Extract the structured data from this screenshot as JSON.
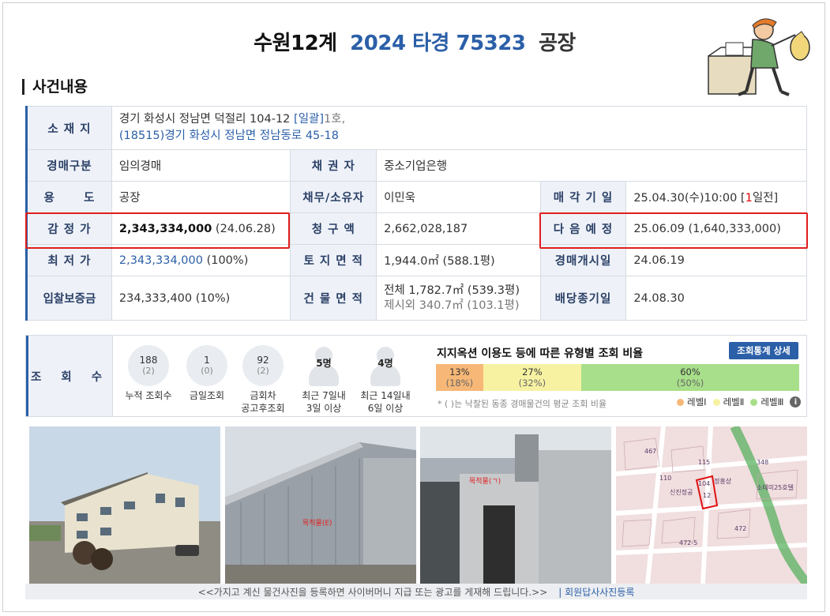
{
  "header": {
    "court": "수원12계",
    "case_no": "2024 타경 75323",
    "category": "공장"
  },
  "section_title": "사건내용",
  "info": {
    "address": {
      "label": "소 재 지",
      "line1": "경기 화성시 정남면 덕절리 104-12",
      "bulk": "[일괄]",
      "line1_suffix": "1호,",
      "line2": "(18515)경기 화성시  정남면 정남동로  45-18"
    },
    "auction_type": {
      "label": "경매구분",
      "value": "임의경매"
    },
    "creditor": {
      "label": "채 권 자",
      "value": "중소기업은행"
    },
    "usage": {
      "label": "용      도",
      "value": "공장"
    },
    "debtor_owner": {
      "label": "채무/소유자",
      "value": "이민욱"
    },
    "sale_date": {
      "label": "매 각 기 일",
      "value_pre": "25.04.30(수)10:00 [",
      "value_red": "1",
      "value_post": "일전]"
    },
    "appraisal": {
      "label": "감 정 가",
      "value": "2,343,334,000",
      "date": "(24.06.28)"
    },
    "claim_amount": {
      "label": "청 구 액",
      "value": "2,662,028,187"
    },
    "next_schedule": {
      "label": "다 음 예 정",
      "value": "25.06.09 (1,640,333,000)"
    },
    "min_price": {
      "label": "최 저 가",
      "value": "2,343,334,000",
      "pct": "(100%)"
    },
    "land_area": {
      "label": "토 지 면 적",
      "value": "1,944.0㎡ (588.1평)"
    },
    "start_date": {
      "label": "경매개시일",
      "value": "24.06.19"
    },
    "deposit": {
      "label": "입찰보증금",
      "value": "234,333,400 (10%)"
    },
    "building_area": {
      "label": "건 물 면 적",
      "line1": "전체 1,782.7㎡ (539.3평)",
      "line2": "제시외 340.7㎡ (103.1평)"
    },
    "dividend_deadline": {
      "label": "배당종기일",
      "value": "24.08.30"
    }
  },
  "views": {
    "label": "조 회 수",
    "stats": [
      {
        "value": "188",
        "sub": "(2)",
        "caption1": "누적 조회수",
        "caption2": ""
      },
      {
        "value": "1",
        "sub": "(0)",
        "caption1": "금일조회",
        "caption2": ""
      },
      {
        "value": "92",
        "sub": "(2)",
        "caption1": "금회차",
        "caption2": "공고후조회"
      }
    ],
    "people": [
      {
        "count": "5명",
        "caption1": "최근 7일내",
        "caption2": "3일 이상"
      },
      {
        "count": "4명",
        "caption1": "최근 14일내",
        "caption2": "6일 이상"
      }
    ],
    "ratio": {
      "title": "지지옥션 이용도 등에 따른 유형별 조회 비율",
      "button": "조회통계 상세",
      "segments": [
        {
          "pct": 13,
          "label": "13%",
          "sub": "(18%)",
          "color": "#f6b777"
        },
        {
          "pct": 27,
          "label": "27%",
          "sub": "(32%)",
          "color": "#f6f2a2"
        },
        {
          "pct": 60,
          "label": "60%",
          "sub": "(50%)",
          "color": "#a8df8a"
        }
      ],
      "note": "* ( )는 낙찰된 동종 경매물건의 평균 조회 비율",
      "legend": [
        {
          "label": "레벨Ⅰ",
          "color": "#f6b777"
        },
        {
          "label": "레벨Ⅱ",
          "color": "#f6f2a2"
        },
        {
          "label": "레벨Ⅲ",
          "color": "#a8df8a"
        }
      ]
    }
  },
  "photos": {
    "footer_text": "<<가지고 계신 물건사진을 등록하면 사이버머니 지급 또는 광고를 게재해 드립니다.>>",
    "register_link": "| 회원답사사진등록",
    "photo2_tag": "목적물(E)",
    "photo3_tag": "목적물(ㄱ)",
    "map_labels": [
      "104",
      "12",
      "신진정공",
      "정흥상",
      "110",
      "115",
      "348",
      "소테미25호텔",
      "472",
      "467",
      "472-5"
    ]
  }
}
